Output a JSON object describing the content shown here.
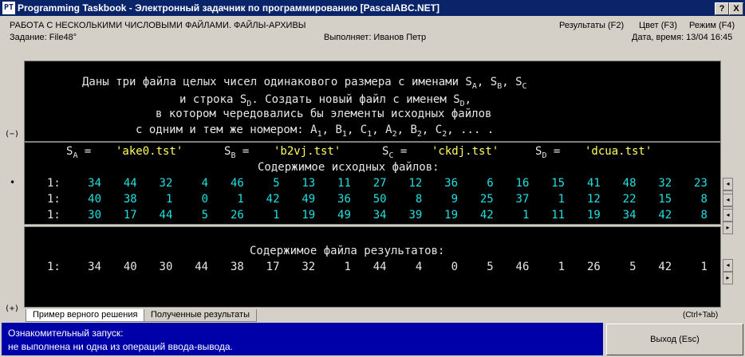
{
  "window": {
    "title": "Programming Taskbook - Электронный задачник по программированию [PascalABC.NET]",
    "icon_label": "PT",
    "help_btn": "?",
    "close_btn": "X"
  },
  "header": {
    "section": "РАБОТА С НЕСКОЛЬКИМИ ЧИСЛОВЫМИ ФАЙЛАМИ. ФАЙЛЫ-АРХИВЫ",
    "task": "Задание: File48°",
    "performer": "Выполняет: Иванов Петр",
    "results_menu": "Результаты (F2)",
    "color_menu": "Цвет (F3)",
    "mode_menu": "Режим (F4)",
    "datetime": "Дата, время: 13/04 16:45"
  },
  "task_text": {
    "line1_pre": "Даны три файла целых чисел одинакового размера с именами S",
    "line1_a": "A",
    "line1_b": "B",
    "line1_c": "C",
    "line2": "и строка S",
    "line2_d": "D",
    "line2_post": ". Создать новый файл с именем S",
    "line3": "в котором чередовались бы элементы исходных файлов",
    "line4": "с одним и тем же номером: A",
    "line4_tail": ", ... ."
  },
  "source": {
    "sa_value": "'ake0.tst'",
    "sb_value": "'b2vj.tst'",
    "sc_value": "'ckdj.tst'",
    "sd_value": "'dcua.tst'",
    "heading": "Содержимое исходных файлов:",
    "rows": [
      {
        "label": "1:",
        "values": [
          34,
          44,
          32,
          4,
          46,
          5,
          13,
          11,
          27,
          12,
          36,
          6,
          16,
          15,
          41,
          48,
          32,
          23
        ]
      },
      {
        "label": "1:",
        "values": [
          40,
          38,
          1,
          0,
          1,
          42,
          49,
          36,
          50,
          8,
          9,
          25,
          37,
          1,
          12,
          22,
          15,
          8
        ]
      },
      {
        "label": "1:",
        "values": [
          30,
          17,
          44,
          5,
          26,
          1,
          19,
          49,
          34,
          39,
          19,
          42,
          1,
          11,
          19,
          34,
          42,
          8
        ]
      }
    ]
  },
  "result": {
    "heading": "Содержимое файла результатов:",
    "label": "1:",
    "values": [
      34,
      40,
      30,
      44,
      38,
      17,
      32,
      1,
      44,
      4,
      0,
      5,
      46,
      1,
      26,
      5,
      42,
      1
    ]
  },
  "side": {
    "collapse": "(−)",
    "expand": "(+)",
    "bullet": "•"
  },
  "tabs": {
    "correct": "Пример верного решения",
    "obtained": "Полученные результаты",
    "hint": "(Ctrl+Tab)"
  },
  "status": {
    "line1": "Ознакомительный запуск:",
    "line2": "не выполнена ни одна из операций ввода-вывода."
  },
  "exit_button": "Выход (Esc)",
  "colors": {
    "panel_bg": "#000000",
    "text_white": "#e6e6e6",
    "text_yellow": "#ffff60",
    "text_cyan": "#20e0e0",
    "status_bg": "#0000a8"
  }
}
